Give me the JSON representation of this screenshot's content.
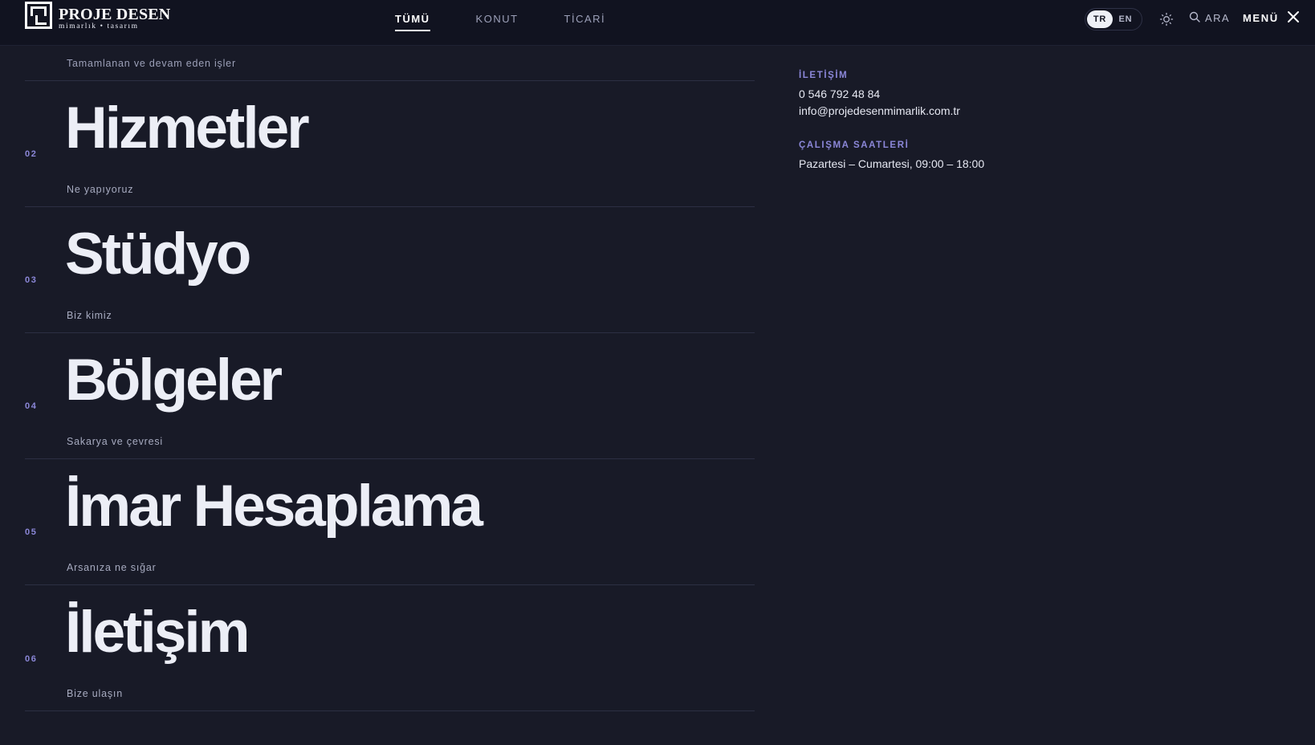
{
  "header": {
    "logo_title": "PROJE DESEN",
    "logo_subtitle": "mimarlık • tasarım",
    "tabs": [
      {
        "label": "TÜMÜ",
        "active": true
      },
      {
        "label": "KONUT",
        "active": false
      },
      {
        "label": "TİCARİ",
        "active": false
      }
    ],
    "languages": [
      {
        "label": "TR",
        "active": true
      },
      {
        "label": "EN",
        "active": false
      }
    ],
    "theme_icon": "sun-icon",
    "search_label": "ARA",
    "search_icon": "search-icon",
    "menu_label": "MENÜ",
    "menu_icon": "close-icon"
  },
  "menu_list": {
    "first_subtitle": "Tamamlanan ve devam eden işler",
    "items": [
      {
        "number": "02",
        "title": "Hizmetler",
        "subtitle": "Ne yapıyoruz"
      },
      {
        "number": "03",
        "title": "Stüdyo",
        "subtitle": "Biz kimiz"
      },
      {
        "number": "04",
        "title": "Bölgeler",
        "subtitle": "Sakarya ve çevresi"
      },
      {
        "number": "05",
        "title": "İmar Hesaplama",
        "subtitle": "Arsanıza ne sığar"
      },
      {
        "number": "06",
        "title": "İletişim",
        "subtitle": "Bize ulaşın"
      }
    ]
  },
  "sidebar": {
    "contact_label": "İLETİŞİM",
    "phone": "0 546 792 48 84",
    "email": "info@projedesenmimarlik.com.tr",
    "hours_label": "ÇALIŞMA SAATLERİ",
    "hours": "Pazartesi – Cumartesi, 09:00 – 18:00"
  },
  "colors": {
    "background": "#181a27",
    "header_bg": "#111320",
    "accent": "#8b87d8",
    "text": "#eceef6"
  }
}
